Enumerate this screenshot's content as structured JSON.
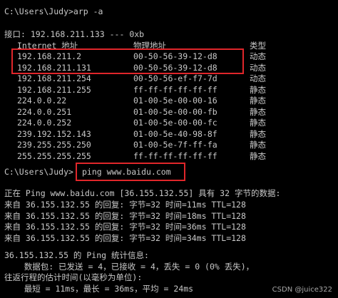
{
  "colors": {
    "background": "#000000",
    "text": "#c8c8c8",
    "highlight_box": "#e0262a"
  },
  "arp": {
    "prompt": "C:\\Users\\Judy>arp -a",
    "interface_line": "接口: 192.168.211.133 --- 0xb",
    "headers": {
      "address": "Internet 地址",
      "mac": "物理地址",
      "type": "类型"
    },
    "rows": [
      {
        "ip": "192.168.211.2",
        "mac": "00-50-56-39-12-d8",
        "type": "动态"
      },
      {
        "ip": "192.168.211.131",
        "mac": "00-50-56-39-12-d8",
        "type": "动态"
      },
      {
        "ip": "192.168.211.254",
        "mac": "00-50-56-ef-f7-7d",
        "type": "动态"
      },
      {
        "ip": "192.168.211.255",
        "mac": "ff-ff-ff-ff-ff-ff",
        "type": "静态"
      },
      {
        "ip": "224.0.0.22",
        "mac": "01-00-5e-00-00-16",
        "type": "静态"
      },
      {
        "ip": "224.0.0.251",
        "mac": "01-00-5e-00-00-fb",
        "type": "静态"
      },
      {
        "ip": "224.0.0.252",
        "mac": "01-00-5e-00-00-fc",
        "type": "静态"
      },
      {
        "ip": "239.192.152.143",
        "mac": "01-00-5e-40-98-8f",
        "type": "静态"
      },
      {
        "ip": "239.255.255.250",
        "mac": "01-00-5e-7f-ff-fa",
        "type": "静态"
      },
      {
        "ip": "255.255.255.255",
        "mac": "ff-ff-ff-ff-ff-ff",
        "type": "静态"
      }
    ]
  },
  "ping": {
    "prompt_path": "C:\\Users\\Judy>",
    "command": "ping www.baidu.com",
    "start_line": "正在 Ping www.baidu.com [36.155.132.55] 具有 32 字节的数据:",
    "replies": [
      "来自 36.155.132.55 的回复: 字节=32 时间=11ms TTL=128",
      "来自 36.155.132.55 的回复: 字节=32 时间=18ms TTL=128",
      "来自 36.155.132.55 的回复: 字节=32 时间=36ms TTL=128",
      "来自 36.155.132.55 的回复: 字节=32 时间=34ms TTL=128"
    ],
    "stats_title": "36.155.132.55 的 Ping 统计信息:",
    "stats_packets": "    数据包: 已发送 = 4，已接收 = 4，丢失 = 0 (0% 丢失)，",
    "rtt_title": "往返行程的估计时间(以毫秒为单位):",
    "rtt_values": "    最短 = 11ms，最长 = 36ms，平均 = 24ms"
  },
  "watermark": "CSDN @juice322"
}
